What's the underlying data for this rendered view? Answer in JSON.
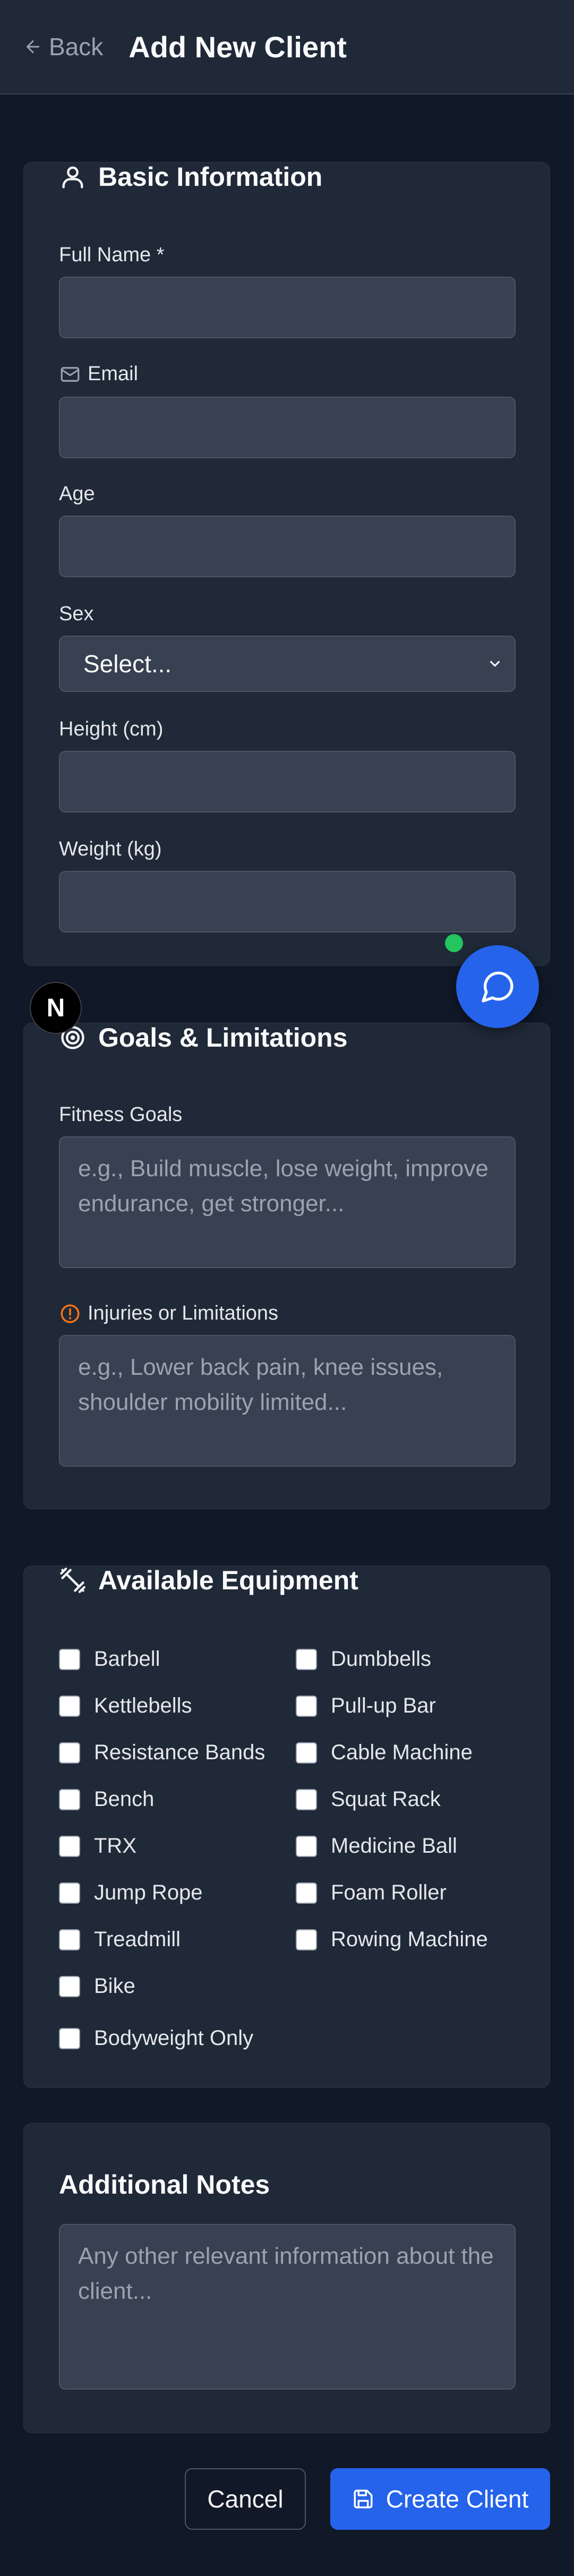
{
  "header": {
    "back_label": "Back",
    "title": "Add New Client"
  },
  "basic": {
    "title": "Basic Information",
    "full_name_label": "Full Name *",
    "email_label": "Email",
    "age_label": "Age",
    "sex_label": "Sex",
    "sex_value": "Select...",
    "height_label": "Height (cm)",
    "weight_label": "Weight (kg)"
  },
  "goals": {
    "title": "Goals & Limitations",
    "fitness_label": "Fitness Goals",
    "fitness_placeholder": "e.g., Build muscle, lose weight, improve endurance, get stronger...",
    "injuries_label": "Injuries or Limitations",
    "injuries_placeholder": "e.g., Lower back pain, knee issues, shoulder mobility limited..."
  },
  "equipment": {
    "title": "Available Equipment",
    "items": [
      "Barbell",
      "Dumbbells",
      "Kettlebells",
      "Pull-up Bar",
      "Resistance Bands",
      "Cable Machine",
      "Bench",
      "Squat Rack",
      "TRX",
      "Medicine Ball",
      "Jump Rope",
      "Foam Roller",
      "Treadmill",
      "Rowing Machine",
      "Bike"
    ],
    "bodyweight": "Bodyweight Only"
  },
  "notes": {
    "title": "Additional Notes",
    "placeholder": "Any other relevant information about the client..."
  },
  "footer": {
    "cancel_label": "Cancel",
    "create_label": "Create Client"
  },
  "badge": {
    "letter": "N"
  },
  "colors": {
    "background": "#111827",
    "card": "#1f2937",
    "accent": "#2563eb",
    "online": "#22c55e",
    "warning": "#f97316"
  }
}
